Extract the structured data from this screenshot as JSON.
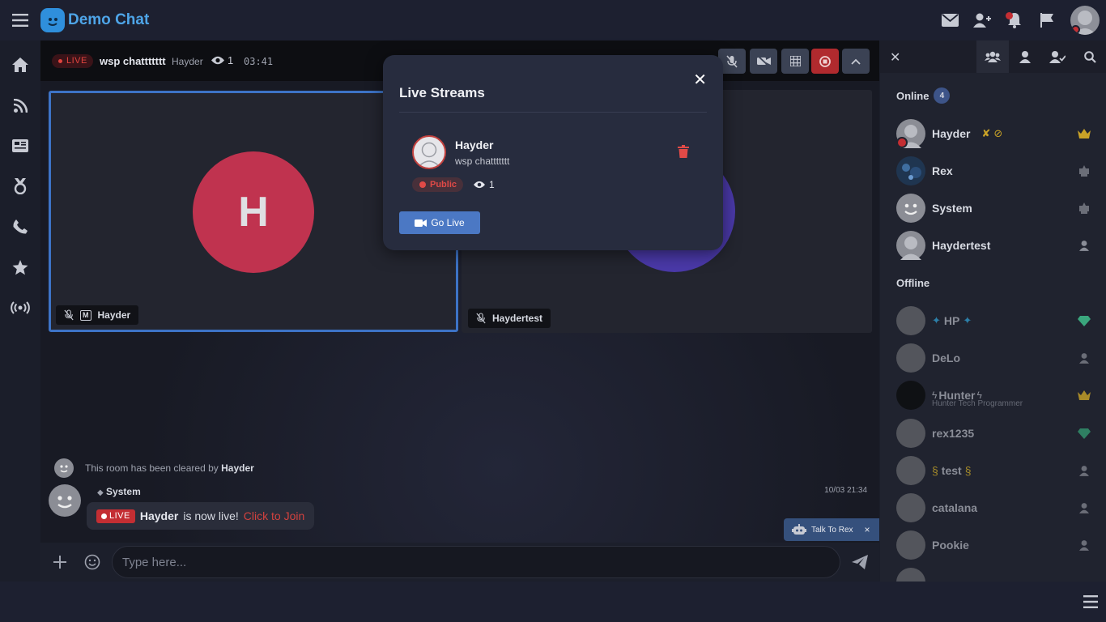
{
  "app": {
    "name": "Demo Chat",
    "logo_letter": ""
  },
  "stream": {
    "live_label": "LIVE",
    "title": "wsp chattttttt",
    "user": "Hayder",
    "viewers": "1",
    "duration": "03:41"
  },
  "tiles": [
    {
      "initial": "H",
      "name": "Hayder",
      "badge": "M"
    },
    {
      "name": "Haydertest"
    }
  ],
  "chat": {
    "cleared_text": "This room has been cleared by",
    "cleared_by": "Hayder",
    "sender": "System",
    "time": "10/03 21:34",
    "live_label": "LIVE",
    "live_user": "Hayder",
    "live_text": "is now live!",
    "join_link": "Click to Join",
    "input_placeholder": "Type here...",
    "rex_label": "Talk To Rex"
  },
  "modal": {
    "title": "Live Streams",
    "streamer": "Hayder",
    "stream_title": "wsp chattttttt",
    "visibility": "Public",
    "viewers": "1",
    "go_live": "Go Live"
  },
  "users": {
    "online_label": "Online",
    "online_count": "4",
    "offline_label": "Offline",
    "online": [
      {
        "name": "Hayder",
        "rank_icon": "crown-icon"
      },
      {
        "name": "Rex",
        "rank_icon": "bot-icon"
      },
      {
        "name": "System",
        "rank_icon": "bot-icon"
      },
      {
        "name": "Haydertest",
        "rank_icon": "user-icon"
      }
    ],
    "offline": [
      {
        "name": "HP",
        "rank_icon": "diamond-icon"
      },
      {
        "name": "DeLo",
        "rank_icon": "user-icon"
      },
      {
        "name": "Hunter",
        "sub": "Hunter Tech Programmer",
        "rank_icon": "crown-icon"
      },
      {
        "name": "rex1235",
        "rank_icon": "diamond-icon"
      },
      {
        "name": "test",
        "rank_icon": "user-icon"
      },
      {
        "name": "catalana",
        "rank_icon": "user-icon"
      },
      {
        "name": "Pookie",
        "rank_icon": "user-icon"
      }
    ]
  },
  "colors": {
    "accent": "#4b78c4",
    "live": "#c42e33",
    "tile_avatar": "#c0334f",
    "crown": "#c9a227",
    "diamond": "#3aa67d"
  }
}
